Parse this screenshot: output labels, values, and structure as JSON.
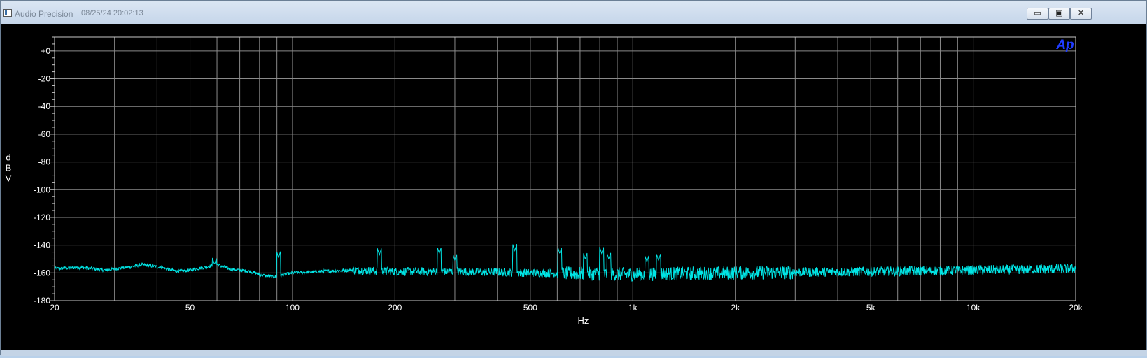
{
  "window": {
    "title": "Audio Precision",
    "timestamp": "08/25/24 20:02:13",
    "buttons": {
      "minimize": "▭",
      "restore": "▣",
      "close": "✕"
    }
  },
  "colors": {
    "trace": "#00e5e5",
    "grid": "#8a8a8a",
    "background": "#000000",
    "text": "#ffffff",
    "logo": "#1f3cff"
  },
  "logo": "Ap",
  "chart_data": {
    "type": "line",
    "xscale": "log",
    "xlim": [
      20,
      20000
    ],
    "ylim": [
      -180,
      10
    ],
    "xlabel": "Hz",
    "ylabel": "dBV",
    "grid": true,
    "x_ticks": [
      {
        "v": 20,
        "label": "20"
      },
      {
        "v": 50,
        "label": "50"
      },
      {
        "v": 100,
        "label": "100"
      },
      {
        "v": 200,
        "label": "200"
      },
      {
        "v": 500,
        "label": "500"
      },
      {
        "v": 1000,
        "label": "1k"
      },
      {
        "v": 2000,
        "label": "2k"
      },
      {
        "v": 5000,
        "label": "5k"
      },
      {
        "v": 10000,
        "label": "10k"
      },
      {
        "v": 20000,
        "label": "20k"
      }
    ],
    "y_ticks": [
      {
        "v": 0,
        "label": "+0"
      },
      {
        "v": -20,
        "label": "-20"
      },
      {
        "v": -40,
        "label": "-40"
      },
      {
        "v": -60,
        "label": "-60"
      },
      {
        "v": -80,
        "label": "-80"
      },
      {
        "v": -100,
        "label": "-100"
      },
      {
        "v": -120,
        "label": "-120"
      },
      {
        "v": -140,
        "label": "-140"
      },
      {
        "v": -160,
        "label": "-160"
      },
      {
        "v": -180,
        "label": "-180"
      }
    ],
    "series": [
      {
        "noise_floor": [
          [
            20,
            -157
          ],
          [
            24,
            -156
          ],
          [
            28,
            -158
          ],
          [
            33,
            -156
          ],
          [
            36,
            -154
          ],
          [
            41,
            -156
          ],
          [
            46,
            -159
          ],
          [
            50,
            -158
          ],
          [
            55,
            -156
          ],
          [
            60,
            -154
          ],
          [
            65,
            -157
          ],
          [
            75,
            -159
          ],
          [
            83,
            -162
          ],
          [
            88,
            -163
          ],
          [
            100,
            -160
          ],
          [
            120,
            -159
          ],
          [
            150,
            -158
          ],
          [
            200,
            -159
          ],
          [
            300,
            -159
          ],
          [
            500,
            -160
          ],
          [
            1000,
            -161
          ],
          [
            2000,
            -160
          ],
          [
            5000,
            -159
          ],
          [
            10000,
            -158
          ],
          [
            20000,
            -157
          ]
        ],
        "peaks": [
          [
            59,
            -154
          ],
          [
            91,
            -149
          ],
          [
            180,
            -147
          ],
          [
            270,
            -146
          ],
          [
            300,
            -151
          ],
          [
            450,
            -144
          ],
          [
            610,
            -146
          ],
          [
            725,
            -150
          ],
          [
            810,
            -146
          ],
          [
            850,
            -150
          ],
          [
            1100,
            -152
          ],
          [
            1190,
            -151
          ]
        ]
      }
    ]
  }
}
